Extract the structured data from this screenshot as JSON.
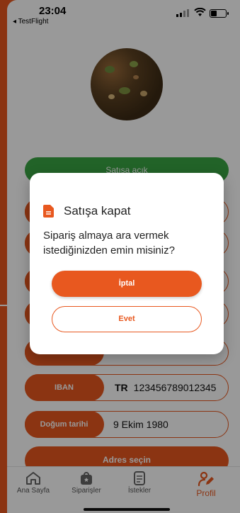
{
  "status_bar": {
    "time": "23:04",
    "back_app": "◂ TestFlight"
  },
  "profile": {
    "sale_status": "Satışa açık",
    "fields": [
      {
        "label": "IBAN",
        "prefix": "TR",
        "value": "123456789012345"
      },
      {
        "label": "Doğum tarihi",
        "value": "9 Ekim 1980"
      }
    ],
    "address_button": "Adres seçin"
  },
  "tabs": [
    {
      "label": "Ana Sayfa",
      "icon": "home-icon"
    },
    {
      "label": "Siparişler",
      "icon": "bag-icon"
    },
    {
      "label": "İstekler",
      "icon": "list-icon"
    },
    {
      "label": "Profil",
      "icon": "profile-edit-icon",
      "active": true
    }
  ],
  "dialog": {
    "icon": "document-icon",
    "title": "Satışa kapat",
    "message": "Sipariş almaya ara vermek istediğinizden emin misiniz?",
    "cancel_label": "İptal",
    "confirm_label": "Evet"
  },
  "colors": {
    "accent": "#e8581f",
    "green": "#3aa643"
  }
}
